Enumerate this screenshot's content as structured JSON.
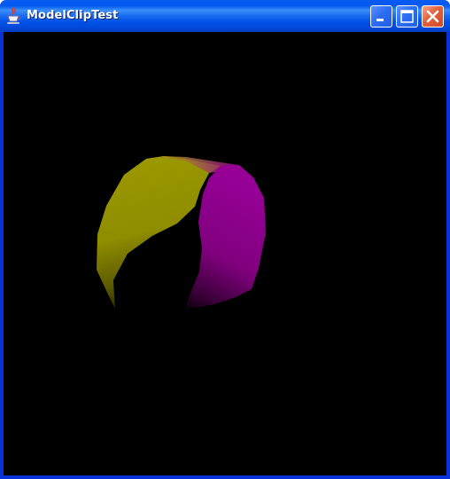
{
  "window": {
    "title": "ModelClipTest",
    "icons": {
      "app": "java-cup-icon",
      "minimize": "minimize-icon",
      "maximize": "maximize-icon",
      "close": "close-icon"
    }
  },
  "scene": {
    "background_color": "#000000",
    "object": "clipped-cylinder",
    "colors": {
      "yellow_face": "#9a9a00",
      "magenta_face": "#8a0088"
    }
  }
}
